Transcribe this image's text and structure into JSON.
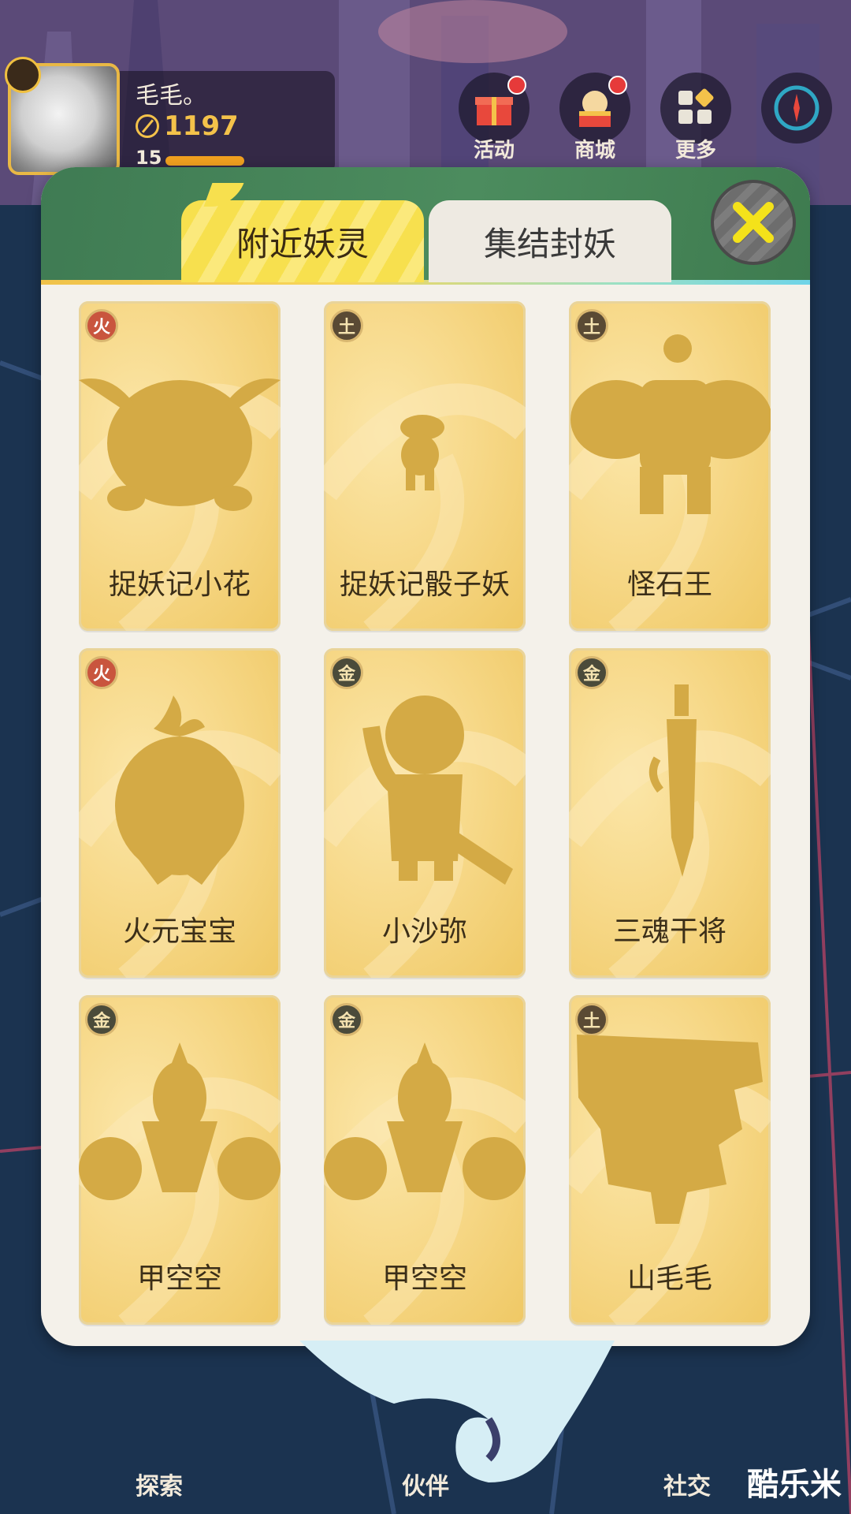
{
  "player": {
    "name": "毛毛。",
    "power": "1197",
    "level": "15"
  },
  "hud_buttons": [
    {
      "label": "活动",
      "icon": "gift-icon"
    },
    {
      "label": "商城",
      "icon": "shop-icon"
    },
    {
      "label": "更多",
      "icon": "grid-icon"
    },
    {
      "label": "",
      "icon": "compass-icon"
    }
  ],
  "tabs": [
    {
      "label": "附近妖灵",
      "active": true
    },
    {
      "label": "集结封妖",
      "active": false
    }
  ],
  "cards": [
    {
      "name": "捉妖记小花",
      "element": "火"
    },
    {
      "name": "捉妖记骰子妖",
      "element": "土"
    },
    {
      "name": "怪石王",
      "element": "土"
    },
    {
      "name": "火元宝宝",
      "element": "火"
    },
    {
      "name": "小沙弥",
      "element": "金"
    },
    {
      "name": "三魂干将",
      "element": "金"
    },
    {
      "name": "甲空空",
      "element": "金"
    },
    {
      "name": "甲空空",
      "element": "金"
    },
    {
      "name": "山毛毛",
      "element": "土"
    }
  ],
  "bottom_nav": [
    {
      "label": "探索"
    },
    {
      "label": "伙伴"
    },
    {
      "label": "社交"
    }
  ],
  "watermark": "酷乐米",
  "colors": {
    "card_gold": "#f7d98a",
    "silhouette": "#d4aa45",
    "tab_active": "#f7e04e",
    "header_green": "#4c8c5e",
    "close_x": "#f4e21a"
  }
}
